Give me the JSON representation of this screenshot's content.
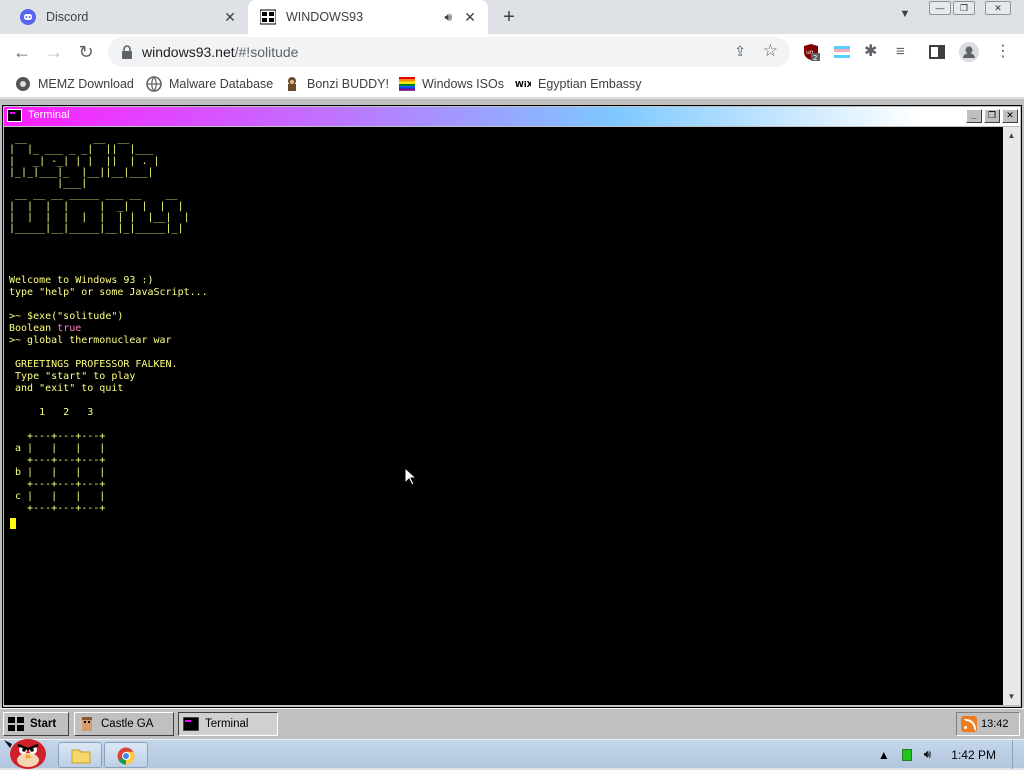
{
  "browser": {
    "tabs": [
      {
        "title": "Discord",
        "icon": "discord-icon",
        "active": false
      },
      {
        "title": "WINDOWS93",
        "icon": "windows93-favicon",
        "active": true
      }
    ],
    "url": {
      "host": "windows93.net",
      "path": "/#!solitude"
    },
    "bookmarks": [
      {
        "label": "MEMZ Download",
        "icon": "memz-icon"
      },
      {
        "label": "Malware Database",
        "icon": "globe-icon"
      },
      {
        "label": "Bonzi BUDDY!",
        "icon": "bonzi-icon"
      },
      {
        "label": "Windows ISOs",
        "icon": "windows-flag-icon"
      },
      {
        "label": "Egyptian Embassy",
        "icon": "wix-icon"
      }
    ],
    "extension_badge": "2"
  },
  "terminal": {
    "title": "Terminal",
    "ascii_art": " __           __  __\n|  |_ ___ _ _|  ||  |___\n|   _| -_| | |  ||  | . |\n|_|_|___|_  |__||__|___|\n        |___|\n __ __ __ _____ ___ __    __\n|  |  |  |     |  _|  |  |  |\n|  |  |  |  |  |  | |  |__|  |\n|_____|__|_____|__|_|_____|_|",
    "welcome_1": "Welcome to Windows 93 :)",
    "welcome_2": "type \"help\" or some JavaScript...",
    "cmd_1": ">~ $exe(\"solitude\")",
    "result_type": "Boolean ",
    "result_value": "true",
    "cmd_2": ">~ global thermonuclear war",
    "greet_1": " GREETINGS PROFESSOR FALKEN.",
    "greet_2": " Type \"start\" to play",
    "greet_3": " and \"exit\" to quit",
    "board": "     1   2   3\n\n   +---+---+---+\n a |   |   |   |\n   +---+---+---+\n b |   |   |   |\n   +---+---+---+\n c |   |   |   |\n   +---+---+---+"
  },
  "w93_taskbar": {
    "start": "Start",
    "items": [
      {
        "label": "Castle GA",
        "pressed": false
      },
      {
        "label": "Terminal",
        "pressed": true
      }
    ],
    "clock": "13:42"
  },
  "win7_taskbar": {
    "clock": "1:42 PM"
  },
  "colors": {
    "terminal_text": "#ffff80",
    "terminal_bg": "#000000",
    "boolean_true": "#ff7fbf"
  }
}
